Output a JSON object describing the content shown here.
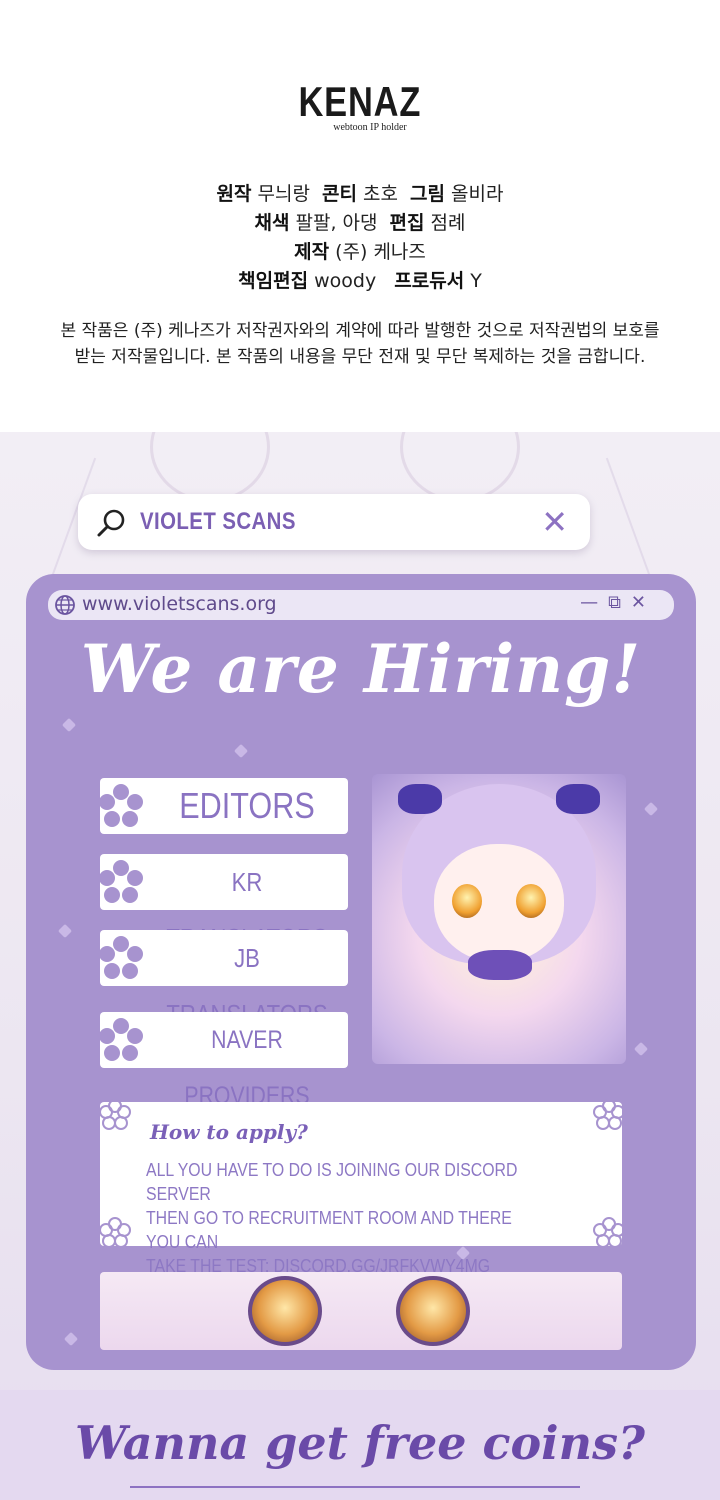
{
  "credits": {
    "logo_main": "KENAZ",
    "logo_sub": "webtoon IP holder",
    "lines": [
      [
        {
          "k": "원작",
          "v": "무늬랑"
        },
        {
          "k": "콘티",
          "v": "초호"
        },
        {
          "k": "그림",
          "v": "올비라"
        }
      ],
      [
        {
          "k": "채색",
          "v": "팔팔, 아댕"
        },
        {
          "k": "편집",
          "v": "점례"
        }
      ],
      [
        {
          "k": "제작",
          "v": "(주) 케나즈"
        }
      ],
      [
        {
          "k": "책임편집",
          "v": "woody"
        },
        {
          "k": "프로듀서",
          "v": "Y"
        }
      ]
    ],
    "notice_line1": "본 작품은 (주) 케나즈가 저작권자와의 계약에 따라 발행한 것으로 저작권법의 보호를",
    "notice_line2": "받는 저작물입니다. 본 작품의 내용을 무단 전재 및 무단 복제하는 것을 금합니다."
  },
  "search": {
    "query": "VIOLET SCANS",
    "close_glyph": "✕"
  },
  "browser": {
    "url": "www.violetscans.org",
    "controls": "—⧉✕"
  },
  "hiring": {
    "title": "We are Hiring!",
    "roles": [
      "EDITORS",
      "KR TRANSLATORS",
      "JB TRANSLATORS",
      "NAVER PROVIDERS"
    ],
    "howto_title": "How to apply?",
    "howto_line1": "ALL YOU HAVE TO DO IS JOINING OUR DISCORD SERVER",
    "howto_line2": "THEN GO TO RECRUITMENT ROOM AND THERE YOU CAN",
    "howto_line3": "TAKE THE TEST: DISCORD.GG/jRFkVWY4mG"
  },
  "coins": {
    "title": "Wanna get free coins?"
  },
  "colors": {
    "panel": "#a793cf",
    "accent": "#7b5fb3",
    "banner_bg": "#ece6f1"
  }
}
